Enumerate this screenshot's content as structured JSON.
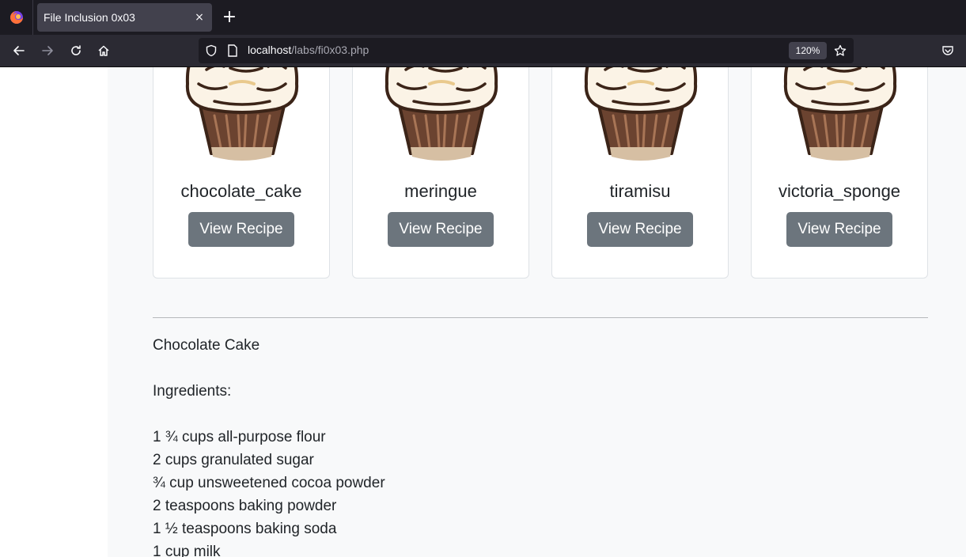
{
  "browser": {
    "tab_title": "File Inclusion 0x03",
    "tab_close": "×",
    "new_tab": "+",
    "url_host": "localhost",
    "url_path": "/labs/fi0x03.php",
    "zoom": "120%"
  },
  "cards": [
    {
      "name": "chocolate_cake",
      "button": "View Recipe"
    },
    {
      "name": "meringue",
      "button": "View Recipe"
    },
    {
      "name": "tiramisu",
      "button": "View Recipe"
    },
    {
      "name": "victoria_sponge",
      "button": "View Recipe"
    }
  ],
  "recipe": {
    "title": "Chocolate Cake",
    "ingredients_heading": "Ingredients:",
    "ingredients": [
      "1 ¾ cups all-purpose flour",
      "2 cups granulated sugar",
      "¾ cup unsweetened cocoa powder",
      "2 teaspoons baking powder",
      "1 ½ teaspoons baking soda",
      "1 cup milk"
    ]
  }
}
